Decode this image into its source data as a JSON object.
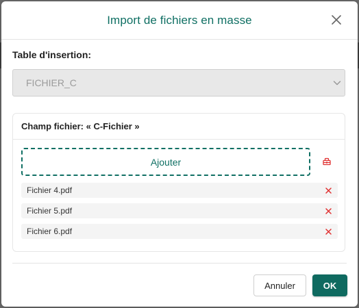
{
  "dialog": {
    "title": "Import de fichiers en masse",
    "close_icon": "close-icon"
  },
  "table_field": {
    "label": "Table d'insertion:",
    "selected_value": "FICHIER_C"
  },
  "file_field": {
    "title": "Champ fichier: « C-Fichier »",
    "add_label": "Ajouter",
    "clear_icon": "eraser-icon",
    "files": [
      {
        "name": "Fichier 4.pdf"
      },
      {
        "name": "Fichier 5.pdf"
      },
      {
        "name": "Fichier 6.pdf"
      }
    ]
  },
  "footer": {
    "cancel_label": "Annuler",
    "ok_label": "OK"
  },
  "colors": {
    "accent": "#0f6f63",
    "danger": "#e03131"
  }
}
